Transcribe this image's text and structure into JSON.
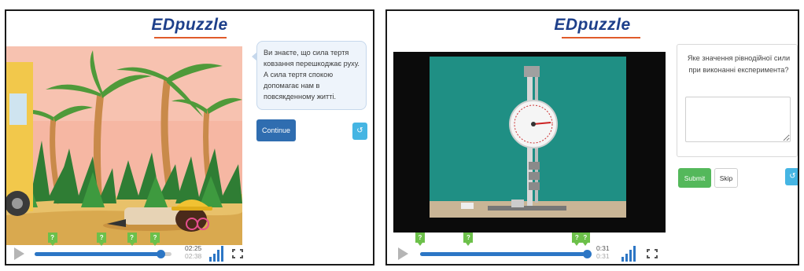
{
  "left": {
    "logo": "EDpuzzle",
    "bubble_text": "Ви знаєте, що сила тертя ковзання  перешкоджає руху. А сила тертя спокою допомагає нам в повсякденному житті.",
    "continue_label": "Continue",
    "undo_glyph": "↺",
    "time_current": "02:25",
    "time_total": "02:38",
    "progress": 0.92,
    "marker_label": "?",
    "marker_positions": [
      0.13,
      0.49,
      0.71,
      0.88
    ]
  },
  "right": {
    "logo": "EDpuzzle",
    "question": "Яке значення рівнодійної сили при виконанні експеримента?",
    "answer_value": "",
    "submit_label": "Submit",
    "skip_label": "Skip",
    "undo_glyph": "↺",
    "time_current": "0:31",
    "time_total": "0:31",
    "progress": 1.0,
    "marker_label": "?",
    "marker_positions": [
      0.0,
      0.29,
      0.94,
      0.99
    ]
  },
  "colors": {
    "accent_blue": "#2c76c5",
    "marker_green": "#6cc04a",
    "submit_green": "#54b85b",
    "undo_blue": "#45b5e3",
    "logo_blue": "#1d3f8a"
  },
  "icons": [
    "play-icon",
    "speed-icon",
    "fullscreen-icon",
    "undo-icon"
  ]
}
